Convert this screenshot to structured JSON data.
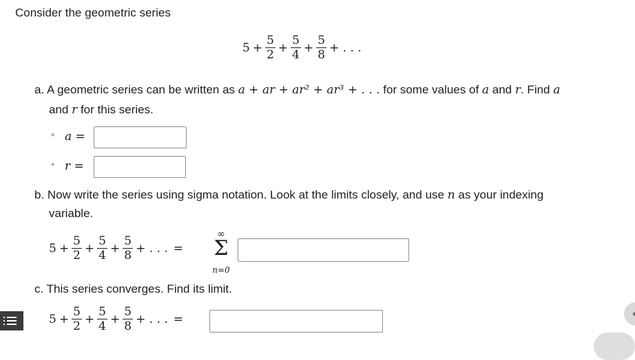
{
  "intro": "Consider the geometric series",
  "series": {
    "lead": "5",
    "plus": "+",
    "numerator": "5",
    "d1": "2",
    "d2": "4",
    "d3": "8",
    "ellipsis": "+ . . .",
    "equals": "="
  },
  "part_a": {
    "text1": "a. A geometric series can be written as ",
    "formula": "a + ar + ar² + ar³ + . . .",
    "text2": " for some values of ",
    "var_a": "a",
    "and": " and ",
    "var_r": "r",
    "text3": ". Find ",
    "line2_var": "a",
    "line2_and": "and ",
    "line2_r": "r",
    "line2_rest": " for this series.",
    "a_label": "a =",
    "r_label": "r =",
    "bullet": "◦",
    "a_value": "",
    "r_value": ""
  },
  "part_b": {
    "text1": "b. Now write the series using sigma notation. Look at the limits closely, and use ",
    "var_n": "n",
    "text2": " as your indexing",
    "text3": "variable.",
    "sigma": "Σ",
    "upper": "∞",
    "lower": "n=0",
    "answer": ""
  },
  "part_c": {
    "text": "c. This series converges. Find its limit.",
    "answer": ""
  }
}
